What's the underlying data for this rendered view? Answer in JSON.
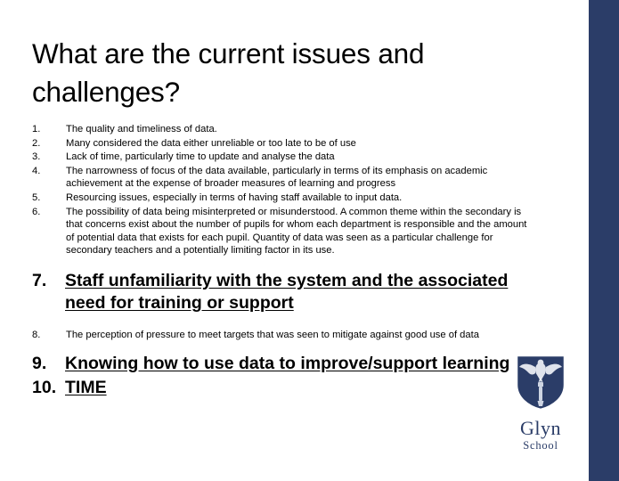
{
  "slide": {
    "title": "What are the current issues and challenges?",
    "accent_color": "#2b3d68",
    "background_color": "#ffffff"
  },
  "list": {
    "items": [
      {
        "number": "1.",
        "text": "The quality and timeliness of data.",
        "emphasis": "normal"
      },
      {
        "number": "2.",
        "text": "Many considered the data either unreliable or too late to be of use",
        "emphasis": "normal"
      },
      {
        "number": "3.",
        "text": "Lack of time, particularly time to update and analyse the data",
        "emphasis": "normal"
      },
      {
        "number": "4.",
        "text": "The narrowness of focus of the data available, particularly in terms of its emphasis on academic achievement at the expense of broader measures of learning and progress",
        "emphasis": "normal"
      },
      {
        "number": "5.",
        "text": "Resourcing issues, especially in terms of having staff available to input data.",
        "emphasis": "normal"
      },
      {
        "number": "6.",
        "text": "The possibility of data being misinterpreted or misunderstood. A common theme within the secondary is that concerns exist about the number of pupils for whom each department is responsible and the amount of potential data that exists for each pupil. Quantity of data was seen as a particular challenge for secondary teachers and a potentially limiting factor in its use.",
        "emphasis": "normal"
      },
      {
        "number": "7.",
        "text": "Staff unfamiliarity with the system and the associated need for training or support",
        "emphasis": "bold-underline"
      },
      {
        "number": "8.",
        "text": "The perception of pressure to meet targets that was seen to mitigate against good use of data",
        "emphasis": "normal"
      },
      {
        "number": "9.",
        "text": "Knowing how to use data to improve/support learning",
        "emphasis": "bold-underline"
      },
      {
        "number": "10.",
        "text": "TIME",
        "emphasis": "bold-underline"
      }
    ]
  },
  "logo": {
    "icon": "glyn-school-crest-icon",
    "name": "Glyn",
    "subtitle": "School",
    "color": "#2b3d68"
  }
}
